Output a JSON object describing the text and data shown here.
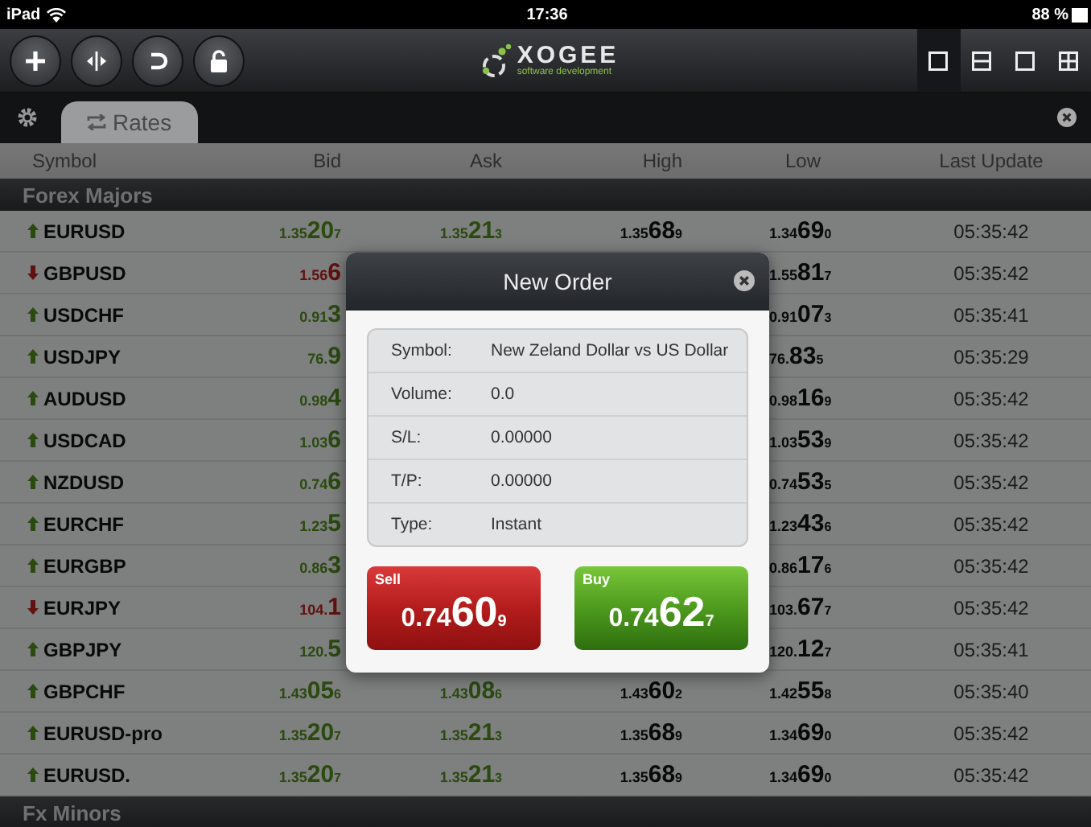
{
  "status_bar": {
    "carrier": "iPad",
    "time": "17:36",
    "battery": "88 %"
  },
  "logo": {
    "name": "XOGEE",
    "tagline": "software development"
  },
  "layout_buttons": [
    {
      "selected": true
    },
    {
      "selected": false
    },
    {
      "selected": false
    },
    {
      "selected": false
    }
  ],
  "tabs": [
    {
      "label": "Rates",
      "selected": true
    }
  ],
  "table": {
    "columns": [
      "Symbol",
      "Bid",
      "Ask",
      "High",
      "Low",
      "Last Update"
    ],
    "groups": [
      {
        "name": "Forex Majors",
        "rows": [
          {
            "symbol": "EURUSD",
            "rising": true,
            "bid": {
              "pre": "1.35",
              "big": "20",
              "pip": "7"
            },
            "ask": {
              "pre": "1.35",
              "big": "21",
              "pip": "3"
            },
            "high": {
              "pre": "1.35",
              "big": "68",
              "pip": "9"
            },
            "low": {
              "pre": "1.34",
              "big": "69",
              "pip": "0"
            },
            "time": "05:35:42"
          },
          {
            "symbol": "GBPUSD",
            "rising": false,
            "bid": {
              "pre": "1.56",
              "big": "6"
            },
            "low": {
              "pre": "1.55",
              "big": "81",
              "pip": "7"
            },
            "time": "05:35:42"
          },
          {
            "symbol": "USDCHF",
            "rising": true,
            "bid": {
              "pre": "0.91",
              "big": "3"
            },
            "low": {
              "pre": "0.91",
              "big": "07",
              "pip": "3"
            },
            "time": "05:35:41"
          },
          {
            "symbol": "USDJPY",
            "rising": true,
            "bid": {
              "pre": "76.",
              "big": "9"
            },
            "low": {
              "pre": "76.",
              "big": "83",
              "pip": "5"
            },
            "time": "05:35:29"
          },
          {
            "symbol": "AUDUSD",
            "rising": true,
            "bid": {
              "pre": "0.98",
              "big": "4"
            },
            "low": {
              "pre": "0.98",
              "big": "16",
              "pip": "9"
            },
            "time": "05:35:42"
          },
          {
            "symbol": "USDCAD",
            "rising": true,
            "bid": {
              "pre": "1.03",
              "big": "6"
            },
            "low": {
              "pre": "1.03",
              "big": "53",
              "pip": "9"
            },
            "time": "05:35:42"
          },
          {
            "symbol": "NZDUSD",
            "rising": true,
            "bid": {
              "pre": "0.74",
              "big": "6"
            },
            "low": {
              "pre": "0.74",
              "big": "53",
              "pip": "5"
            },
            "time": "05:35:42"
          },
          {
            "symbol": "EURCHF",
            "rising": true,
            "bid": {
              "pre": "1.23",
              "big": "5"
            },
            "low": {
              "pre": "1.23",
              "big": "43",
              "pip": "6"
            },
            "time": "05:35:42"
          },
          {
            "symbol": "EURGBP",
            "rising": true,
            "bid": {
              "pre": "0.86",
              "big": "3"
            },
            "low": {
              "pre": "0.86",
              "big": "17",
              "pip": "6"
            },
            "time": "05:35:42"
          },
          {
            "symbol": "EURJPY",
            "rising": false,
            "bid": {
              "pre": "104.",
              "big": "1"
            },
            "low": {
              "pre": "103.",
              "big": "67",
              "pip": "7"
            },
            "time": "05:35:42"
          },
          {
            "symbol": "GBPJPY",
            "rising": true,
            "bid": {
              "pre": "120.",
              "big": "5"
            },
            "low": {
              "pre": "120.",
              "big": "12",
              "pip": "7"
            },
            "time": "05:35:41"
          },
          {
            "symbol": "GBPCHF",
            "rising": true,
            "bid": {
              "pre": "1.43",
              "big": "05",
              "pip": "6"
            },
            "ask": {
              "pre": "1.43",
              "big": "08",
              "pip": "6"
            },
            "high": {
              "pre": "1.43",
              "big": "60",
              "pip": "2"
            },
            "low": {
              "pre": "1.42",
              "big": "55",
              "pip": "8"
            },
            "time": "05:35:40"
          },
          {
            "symbol": "EURUSD-pro",
            "rising": true,
            "bid": {
              "pre": "1.35",
              "big": "20",
              "pip": "7"
            },
            "ask": {
              "pre": "1.35",
              "big": "21",
              "pip": "3"
            },
            "high": {
              "pre": "1.35",
              "big": "68",
              "pip": "9"
            },
            "low": {
              "pre": "1.34",
              "big": "69",
              "pip": "0"
            },
            "time": "05:35:42"
          },
          {
            "symbol": "EURUSD.",
            "rising": true,
            "bid": {
              "pre": "1.35",
              "big": "20",
              "pip": "7"
            },
            "ask": {
              "pre": "1.35",
              "big": "21",
              "pip": "3"
            },
            "high": {
              "pre": "1.35",
              "big": "68",
              "pip": "9"
            },
            "low": {
              "pre": "1.34",
              "big": "69",
              "pip": "0"
            },
            "time": "05:35:42"
          }
        ]
      },
      {
        "name": "Fx Minors"
      }
    ]
  },
  "dialog": {
    "title": "New Order",
    "fields": [
      {
        "label": "Symbol:",
        "value": "New Zeland Dollar vs US Dollar"
      },
      {
        "label": "Volume:",
        "value": "0.0"
      },
      {
        "label": "S/L:",
        "value": "0.00000"
      },
      {
        "label": "T/P:",
        "value": "0.00000"
      },
      {
        "label": "Type:",
        "value": "Instant"
      }
    ],
    "actions": [
      {
        "kind": "sell",
        "label": "Sell",
        "price": {
          "pre": "0.74",
          "big": "60",
          "pip": "9"
        }
      },
      {
        "kind": "buy",
        "label": "Buy",
        "price": {
          "pre": "0.74",
          "big": "62",
          "pip": "7"
        }
      }
    ]
  }
}
